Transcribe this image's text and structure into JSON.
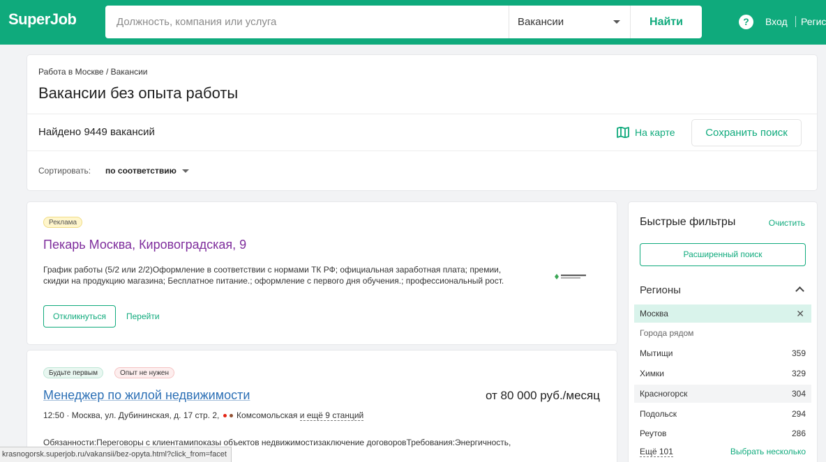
{
  "header": {
    "logo": "SuperJob",
    "search_placeholder": "Должность, компания или услуга",
    "type_selected": "Вакансии",
    "find_label": "Найти",
    "help_symbol": "?",
    "login_label": "Вход",
    "register_label": "Регистрация"
  },
  "top": {
    "breadcrumb": "Работа в Москве / Вакансии",
    "title": "Вакансии без опыта работы",
    "found": "Найдено 9449 вакансий",
    "map_label": "На карте",
    "save_search": "Сохранить поиск",
    "sort_label": "Сортировать:",
    "sort_value": "по соответствию"
  },
  "vacancies": [
    {
      "badges": [
        "Реклама"
      ],
      "title": "Пекарь Москва, Кировоградская, 9",
      "description": "График работы (5/2 или 2/2)Оформление в соответствии с нормами ТК РФ; официальная заработная плата; премии, скидки на продукцию магазина; Бесплатное питание.; оформление с первого дня обучения.; профессиональный рост.",
      "respond_label": "Откликнуться",
      "go_label": "Перейти"
    },
    {
      "badges": [
        "Будьте первым",
        "Опыт не нужен"
      ],
      "title": "Менеджер по жилой недвижимости",
      "salary": "от 80 000 руб./месяц",
      "address": "12:50 · Москва, ул. Дубининская, д. 17 стр. 2,",
      "metro": "Комсомольская",
      "more_stations": "и ещё 9 станций",
      "description": "Обязанности:Переговоры с клиентамипоказы объектов недвижимостизаключение договоровТребования:Энергичность,"
    }
  ],
  "sidebar": {
    "title": "Быстрые фильтры",
    "clear_label": "Очистить",
    "advanced_search": "Расширенный поиск",
    "section_title": "Регионы",
    "selected_region": "Москва",
    "nearby_label": "Города рядом",
    "regions": [
      {
        "name": "Мытищи",
        "count": "359"
      },
      {
        "name": "Химки",
        "count": "329"
      },
      {
        "name": "Красногорск",
        "count": "304"
      },
      {
        "name": "Подольск",
        "count": "294"
      },
      {
        "name": "Реутов",
        "count": "286"
      }
    ],
    "more_label": "Ещё 101",
    "multi_select": "Выбрать несколько"
  },
  "status_url": "krasnogorsk.superjob.ru/vakansii/bez-opyta.html?click_from=facet",
  "colors": {
    "brand": "#0faa7c",
    "visited_link": "#7e2c9c",
    "link": "#2b6fb5",
    "metro_red": "#e42313",
    "metro_brown": "#915133"
  }
}
